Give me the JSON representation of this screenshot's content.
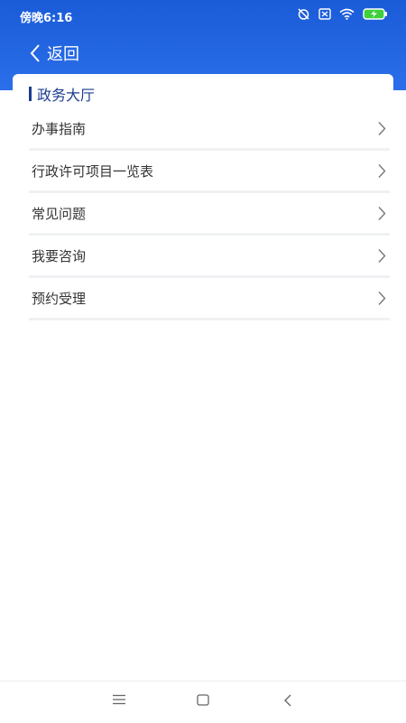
{
  "status": {
    "time": "傍晚6:16",
    "icons": [
      "alarm-off-icon",
      "sim-x-icon",
      "wifi-icon",
      "battery-charging-icon"
    ]
  },
  "header": {
    "back_label": "返回",
    "back_icon": "chevron-left-icon",
    "color": "#1a5bd8"
  },
  "section": {
    "title": "政务大厅",
    "accent_color": "#1c3d8f"
  },
  "menu": {
    "items": [
      {
        "label": "办事指南"
      },
      {
        "label": "行政许可项目一览表"
      },
      {
        "label": "常见问题"
      },
      {
        "label": "我要咨询"
      },
      {
        "label": "预约受理"
      }
    ],
    "chevron_icon": "chevron-right-icon"
  },
  "system_nav": {
    "icons": [
      "menu-icon",
      "home-square-icon",
      "back-triangle-icon"
    ]
  }
}
